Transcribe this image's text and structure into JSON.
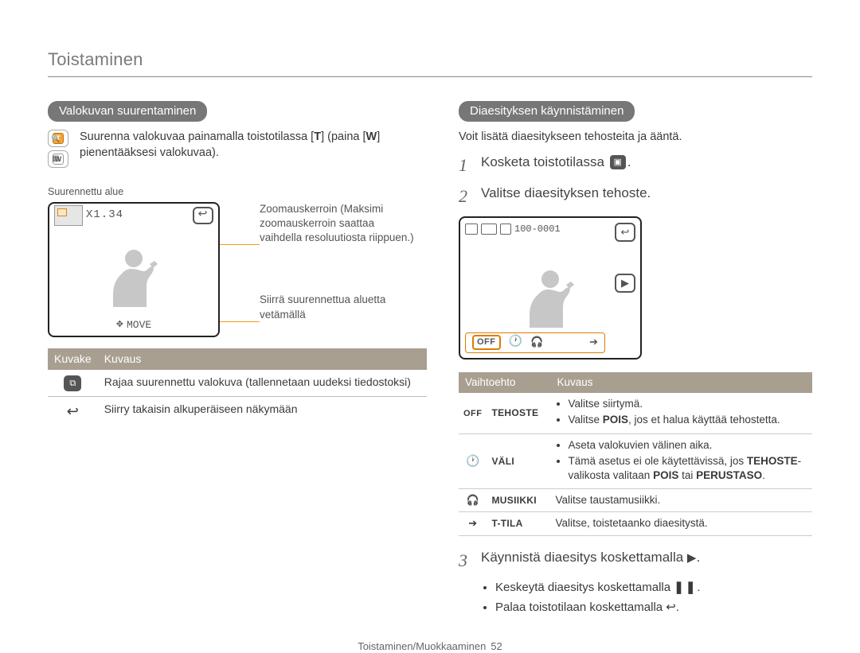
{
  "page_title": "Toistaminen",
  "left": {
    "heading": "Valokuvan suurentaminen",
    "intro_1": "Suurenna valokuvaa painamalla toistotilassa [",
    "intro_t": "T",
    "intro_2": "] (paina [",
    "intro_w": "W",
    "intro_3": "] pienentääksesi valokuvaa).",
    "caption_top": "Suurennettu alue",
    "zoom_value": "X1.34",
    "move_label": "MOVE",
    "annot_zoom": "Zoomauskerroin (Maksimi zoomauskerroin saattaa vaihdella resoluutiosta riippuen.)",
    "annot_drag": "Siirrä suurennettua aluetta vetämällä",
    "table_h1": "Kuvake",
    "table_h2": "Kuvaus",
    "row1": "Rajaa suurennettu valokuva (tallennetaan uudeksi tiedostoksi)",
    "row2": "Siirry takaisin alkuperäiseen näkymään"
  },
  "right": {
    "heading": "Diaesityksen käynnistäminen",
    "intro": "Voit lisätä diaesitykseen tehosteita ja ääntä.",
    "step1": "Kosketa toistotilassa",
    "step2": "Valitse diaesityksen tehoste.",
    "cam_counter": "100-0001",
    "off_label": "OFF",
    "table_h1": "Vaihtoehto",
    "table_h2": "Kuvaus",
    "r1_label": "TEHOSTE",
    "r1_b1": "Valitse siirtymä.",
    "r1_b2a": "Valitse ",
    "r1_b2b": "POIS",
    "r1_b2c": ", jos et halua käyttää tehostetta.",
    "r2_label": "VÄLI",
    "r2_b1": "Aseta valokuvien välinen aika.",
    "r2_b2a": "Tämä asetus ei ole käytettävissä, jos ",
    "r2_b2b": "TEHOSTE",
    "r2_b2c": "-valikosta valitaan ",
    "r2_b2d": "POIS",
    "r2_b2e": " tai ",
    "r2_b2f": "PERUSTASO",
    "r2_b2g": ".",
    "r3_label": "MUSIIKKI",
    "r3_desc": "Valitse taustamusiikki.",
    "r4_label": "T-TILA",
    "r4_desc": "Valitse, toistetaanko diaesitystä.",
    "step3": "Käynnistä diaesitys koskettamalla",
    "b_after1": "Keskeytä diaesitys koskettamalla",
    "b_after2": "Palaa toistotilaan koskettamalla"
  },
  "footer": {
    "section": "Toistaminen/Muokkaaminen",
    "page": "52"
  }
}
